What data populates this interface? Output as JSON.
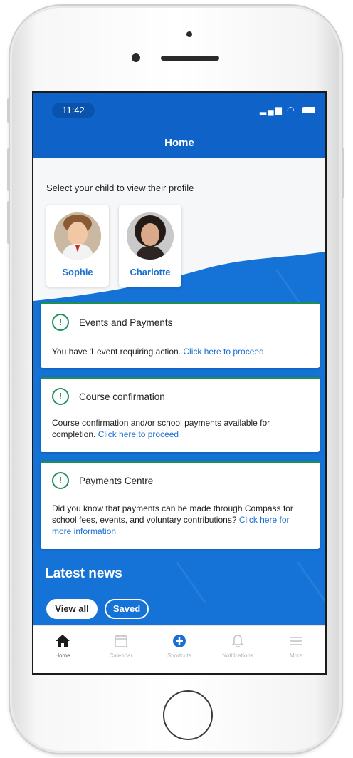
{
  "status_bar": {
    "time": "11:42"
  },
  "nav": {
    "title": "Home"
  },
  "children_section": {
    "prompt": "Select your child to view their profile",
    "children": [
      {
        "name": "Sophie"
      },
      {
        "name": "Charlotte"
      }
    ]
  },
  "cards": [
    {
      "title": "Events and Payments",
      "body": "You have 1 event requiring action. ",
      "link": "Click here to proceed"
    },
    {
      "title": "Course confirmation",
      "body": "Course confirmation and/or school payments available for completion. ",
      "link": "Click here to proceed"
    },
    {
      "title": "Payments Centre",
      "body": "Did you know that payments can be made through Compass for school fees, events, and voluntary contributions? ",
      "link": "Click here for more information"
    }
  ],
  "news": {
    "title": "Latest news",
    "filters": [
      {
        "label": "View all",
        "active": true
      },
      {
        "label": "Saved",
        "active": false
      }
    ]
  },
  "tabbar": {
    "items": [
      {
        "label": "Home",
        "icon": "home-icon",
        "active": true
      },
      {
        "label": "Calendar",
        "icon": "calendar-icon",
        "active": false
      },
      {
        "label": "Shortcuts",
        "icon": "plus-circle-icon",
        "active": false
      },
      {
        "label": "Notifications",
        "icon": "bell-icon",
        "active": false
      },
      {
        "label": "More",
        "icon": "menu-icon",
        "active": false
      }
    ]
  },
  "colors": {
    "brand_blue": "#1572d6",
    "header_blue": "#0f63c8",
    "link_blue": "#1a6fd0",
    "alert_green": "#1f8f5a"
  }
}
